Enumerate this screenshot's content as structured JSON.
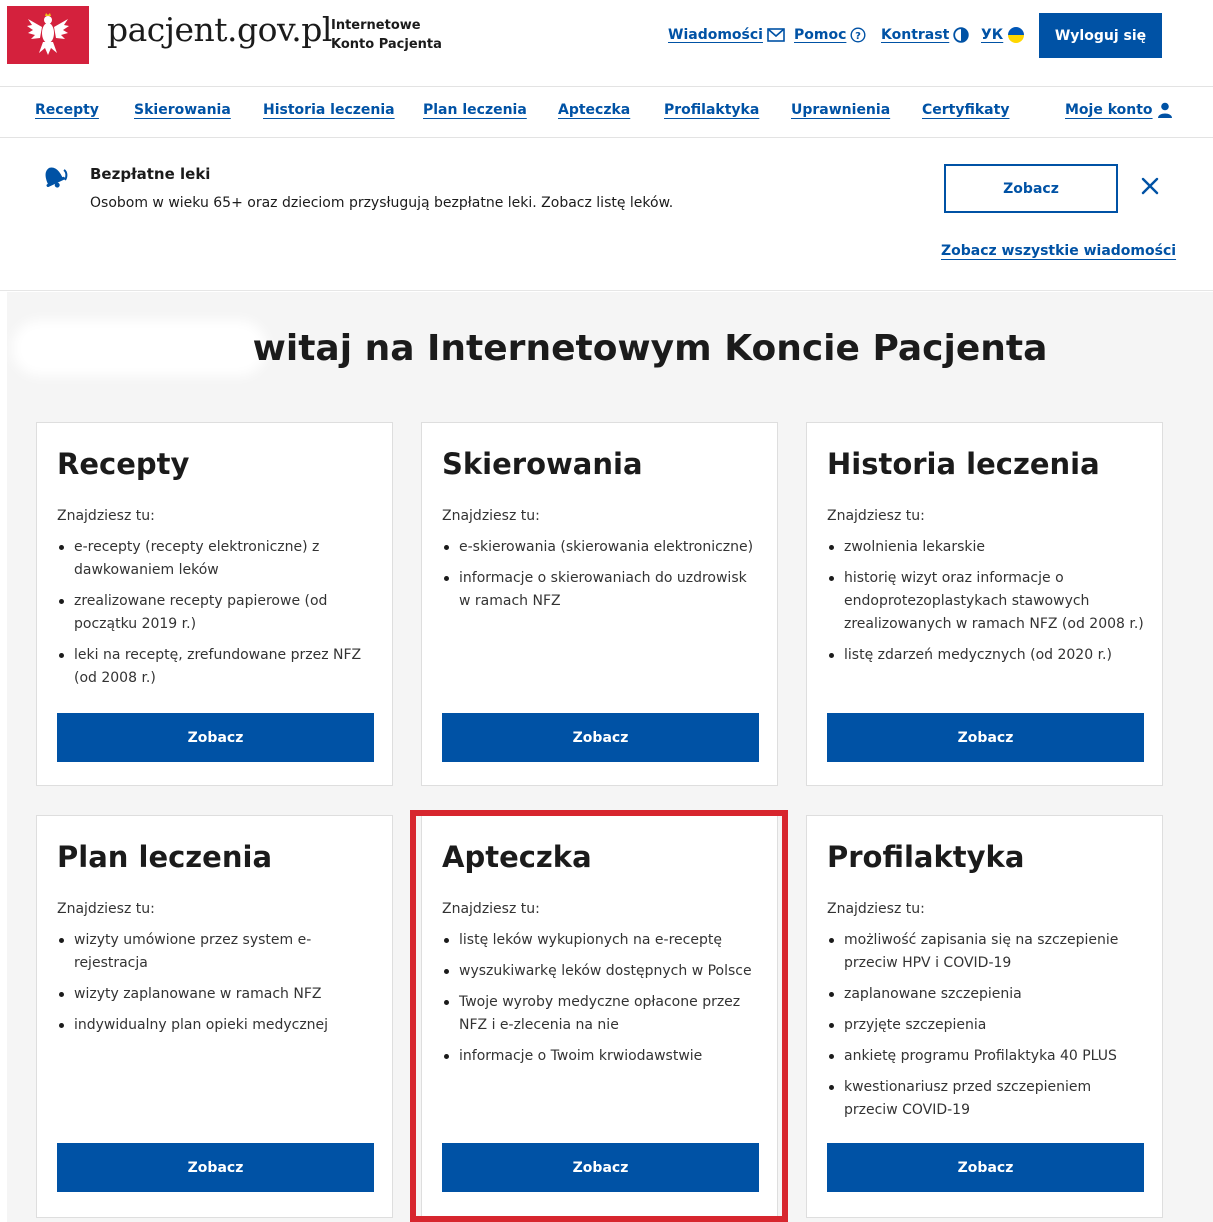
{
  "header": {
    "site_name": "pacjent.gov.pl",
    "site_sub_line1": "Internetowe",
    "site_sub_line2": "Konto Pacjenta",
    "links": {
      "messages": "Wiadomości",
      "help": "Pomoc",
      "contrast": "Kontrast",
      "uk": "УК"
    },
    "logout": "Wyloguj się"
  },
  "nav": {
    "items": [
      "Recepty",
      "Skierowania",
      "Historia leczenia",
      "Plan leczenia",
      "Apteczka",
      "Profilaktyka",
      "Uprawnienia",
      "Certyfikaty",
      "Moje konto"
    ]
  },
  "notice": {
    "title": "Bezpłatne leki",
    "text": "Osobom w wieku 65+ oraz dzieciom przysługują bezpłatne leki. Zobacz listę leków.",
    "button": "Zobacz",
    "all_link": "Zobacz wszystkie wiadomości"
  },
  "welcome": "witaj na Internetowym Koncie Pacjenta",
  "cards": [
    {
      "title": "Recepty",
      "intro": "Znajdziesz tu:",
      "items": [
        "e-recepty (recepty elektroniczne) z dawkowaniem leków",
        "zrealizowane recepty papierowe (od początku 2019 r.)",
        "leki na receptę, zrefundowane przez NFZ (od 2008 r.)"
      ],
      "button": "Zobacz"
    },
    {
      "title": "Skierowania",
      "intro": "Znajdziesz tu:",
      "items": [
        "e-skierowania (skierowania elektroniczne)",
        "informacje o skierowaniach do uzdrowisk w ramach NFZ"
      ],
      "button": "Zobacz"
    },
    {
      "title": "Historia leczenia",
      "intro": "Znajdziesz tu:",
      "items": [
        "zwolnienia lekarskie",
        "historię wizyt oraz informacje o endoprotezoplastykach stawowych zrealizowanych w ramach NFZ (od 2008 r.)",
        "listę zdarzeń medycznych (od 2020 r.)"
      ],
      "button": "Zobacz"
    },
    {
      "title": "Plan leczenia",
      "intro": "Znajdziesz tu:",
      "items": [
        "wizyty umówione przez system e-rejestracja",
        "wizyty zaplanowane w ramach NFZ",
        "indywidualny plan opieki medycznej"
      ],
      "button": "Zobacz"
    },
    {
      "title": "Apteczka",
      "intro": "Znajdziesz tu:",
      "items": [
        "listę leków wykupionych na e-receptę",
        "wyszukiwarkę leków dostępnych w Polsce",
        "Twoje wyroby medyczne opłacone przez NFZ i e-zlecenia na nie",
        "informacje o Twoim krwiodawstwie"
      ],
      "button": "Zobacz"
    },
    {
      "title": "Profilaktyka",
      "intro": "Znajdziesz tu:",
      "items": [
        "możliwość zapisania się na szczepienie przeciw HPV i COVID-19",
        "zaplanowane szczepienia",
        "przyjęte szczepienia",
        "ankietę programu Profilaktyka 40 PLUS",
        "kwestionariusz przed szczepieniem przeciw COVID-19"
      ],
      "button": "Zobacz"
    }
  ],
  "colors": {
    "brand_blue": "#0052a5",
    "logo_red": "#d4213d",
    "highlight_red": "#d7262e"
  },
  "icons": [
    "eagle-emblem-icon",
    "envelope-icon",
    "question-circle-icon",
    "contrast-icon",
    "ukraine-flag-icon",
    "user-icon",
    "bell-icon",
    "close-icon"
  ]
}
